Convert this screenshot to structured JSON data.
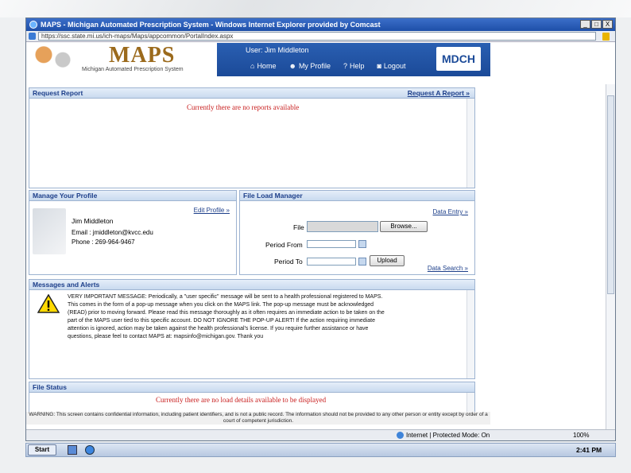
{
  "window": {
    "title": "MAPS - Michigan Automated Prescription System - Windows Internet Explorer provided by Comcast",
    "url": "https://ssc.state.mi.us/ich-maps/Maps/appcommon/PortalIndex.aspx",
    "controls": [
      "_",
      "□",
      "X"
    ]
  },
  "banner": {
    "logo": "MAPS",
    "subtitle": "Michigan Automated Prescription System",
    "user": "User: Jim Middleton",
    "nav": {
      "home": "Home",
      "profile": "My Profile",
      "help": "Help",
      "logout": "Logout"
    },
    "agency": "MDCH"
  },
  "request_report": {
    "title": "Request Report",
    "link": "Request A Report »",
    "message": "Currently there are no reports available"
  },
  "profile": {
    "title": "Manage Your Profile",
    "edit_link": "Edit Profile »",
    "name": "Jim Middleton",
    "email": "Email : jmiddleton@kvcc.edu",
    "phone": "Phone : 269-964-9467"
  },
  "file_load": {
    "title": "File Load Manager",
    "data_entry_link": "Data Entry »",
    "file_label": "File",
    "browse_label": "Browse...",
    "period_from_label": "Period From",
    "period_to_label": "Period To",
    "upload_label": "Upload",
    "data_search_link": "Data Search »"
  },
  "alerts": {
    "title": "Messages and Alerts",
    "text": "VERY IMPORTANT MESSAGE: Periodically, a \"user specific\" message will be sent to a health professional registered to MAPS. This comes in the form of a pop-up message when you click on the MAPS link. The pop-up message must be acknowledged (READ) prior to moving forward. Please read this message thoroughly as it often requires an immediate action to be taken on the part of the MAPS user tied to this specific account. DO NOT IGNORE THE POP-UP ALERT! If the action requiring immediate attention is ignored, action may be taken against the health professional's license. If you require further assistance or have questions, please feel to contact MAPS at: mapsinfo@michigan.gov. Thank you"
  },
  "file_status": {
    "title": "File Status",
    "message": "Currently there are no load details available to be displayed"
  },
  "warning": "WARNING: This screen contains confidential information, including patient identifiers, and is not a public record. The information should not be provided to any other person or entity except by order of a court of competent jurisdiction.",
  "statusbar": {
    "zone": "Internet | Protected Mode: On",
    "zoom": "100%"
  },
  "taskbar": {
    "start": "Start",
    "time": "2:41 PM"
  }
}
